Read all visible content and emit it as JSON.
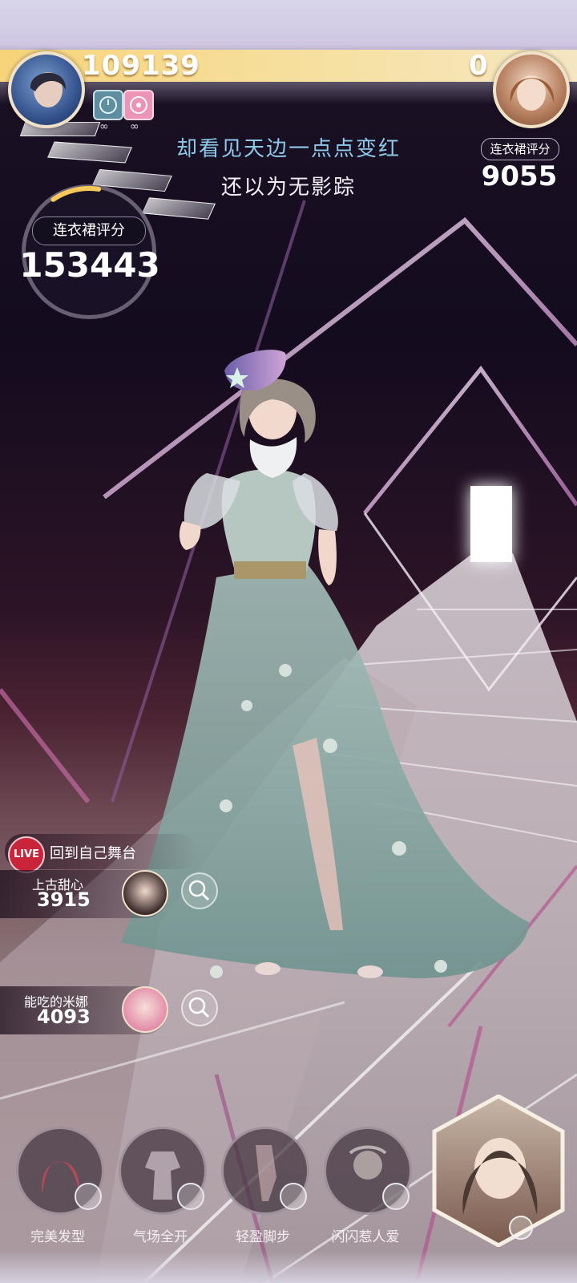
{
  "header": {
    "left_score": "109139",
    "right_score": "0",
    "badge_count_a": "∞",
    "badge_count_b": "∞"
  },
  "lyrics": {
    "line1": "却看见天边一点点变红",
    "line2": "还以为无影踪"
  },
  "opponent": {
    "score_label": "连衣裙评分",
    "score_value": "9055"
  },
  "player": {
    "score_label": "连衣裙评分",
    "score_value": "153443",
    "progress_fraction": 0.12
  },
  "live": {
    "badge": "LIVE",
    "label": "回到自己舞台"
  },
  "rivals": [
    {
      "name": "上古甜心",
      "score": "3915"
    },
    {
      "name": "能吃的米娜",
      "score": "4093"
    }
  ],
  "skills": [
    {
      "label": "完美发型",
      "icon": "hairstyle-icon"
    },
    {
      "label": "气场全开",
      "icon": "dress-icon"
    },
    {
      "label": "轻盈脚步",
      "icon": "pose-icon"
    },
    {
      "label": "闪闪惹人爱",
      "icon": "sparkle-icon"
    }
  ],
  "colors": {
    "gold_bar": "#f7d47a",
    "lyric_blue": "#8ec9ea",
    "live_red": "#c9243a"
  }
}
